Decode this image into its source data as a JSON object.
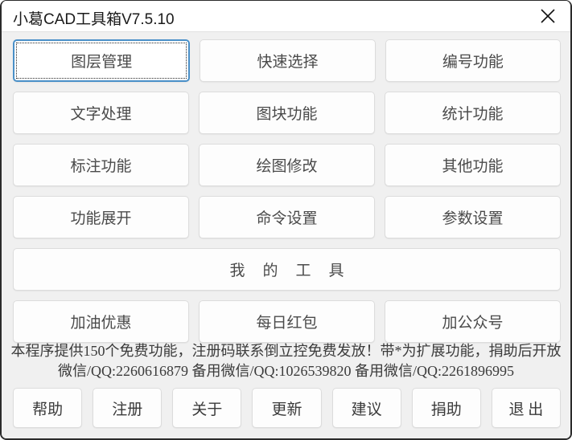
{
  "window": {
    "title": "小葛CAD工具箱V7.5.10",
    "close_icon": "close-icon"
  },
  "grid": {
    "rows": [
      [
        {
          "label": "图层管理",
          "focused": true
        },
        {
          "label": "快速选择",
          "focused": false
        },
        {
          "label": "编号功能",
          "focused": false
        }
      ],
      [
        {
          "label": "文字处理",
          "focused": false
        },
        {
          "label": "图块功能",
          "focused": false
        },
        {
          "label": "统计功能",
          "focused": false
        }
      ],
      [
        {
          "label": "标注功能",
          "focused": false
        },
        {
          "label": "绘图修改",
          "focused": false
        },
        {
          "label": "其他功能",
          "focused": false
        }
      ],
      [
        {
          "label": "功能展开",
          "focused": false
        },
        {
          "label": "命令设置",
          "focused": false
        },
        {
          "label": "参数设置",
          "focused": false
        }
      ]
    ],
    "wide_button": {
      "label": "我的工具"
    },
    "promo_row": [
      {
        "label": "加油优惠"
      },
      {
        "label": "每日红包"
      },
      {
        "label": "加公众号"
      }
    ]
  },
  "info": {
    "line1": "本程序提供150个免费功能，注册码联系倒立控免费发放！带*为扩展功能，捐助后开放",
    "line2": "微信/QQ:2260616879  备用微信/QQ:1026539820  备用微信/QQ:2261896995"
  },
  "bottom_bar": {
    "buttons": [
      {
        "label": "帮助"
      },
      {
        "label": "注册"
      },
      {
        "label": "关于"
      },
      {
        "label": "更新"
      },
      {
        "label": "建议"
      },
      {
        "label": "捐助"
      },
      {
        "label": "退 出"
      }
    ]
  },
  "colors": {
    "background": "#f0f0f0",
    "titlebar": "#ffffff",
    "button_face": "#fdfdfd",
    "button_border": "#dcdcdc",
    "focus_border": "#4a90c8",
    "text": "#4a4a4a",
    "window_border": "#2b2b2b"
  }
}
